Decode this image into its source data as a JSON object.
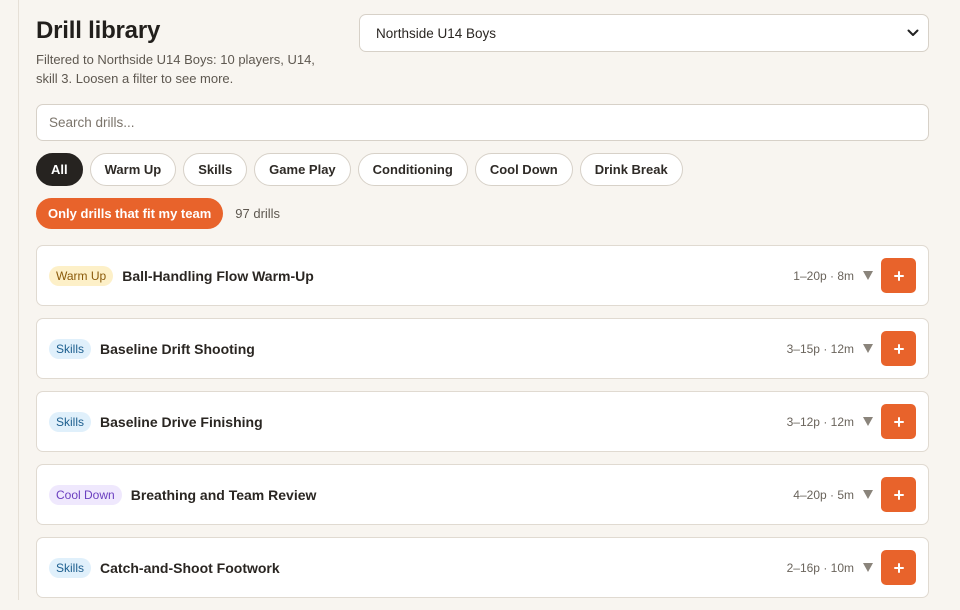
{
  "header": {
    "title": "Drill library",
    "subtitle": "Filtered to Northside U14 Boys: 10 players, U14, skill 3. Loosen a filter to see more."
  },
  "team_select": {
    "value": "Northside U14 Boys",
    "icon": "chevron-down-icon"
  },
  "search": {
    "placeholder": "Search drills...",
    "value": ""
  },
  "filters": {
    "chips": [
      {
        "label": "All",
        "active": true
      },
      {
        "label": "Warm Up",
        "active": false
      },
      {
        "label": "Skills",
        "active": false
      },
      {
        "label": "Game Play",
        "active": false
      },
      {
        "label": "Conditioning",
        "active": false
      },
      {
        "label": "Cool Down",
        "active": false
      },
      {
        "label": "Drink Break",
        "active": false
      }
    ],
    "fit_toggle_label": "Only drills that fit my team",
    "count_text": "97 drills"
  },
  "colors": {
    "accent": "#e8632b",
    "chip_active": "#262320",
    "warm_up_bg": "#fdf0c8",
    "warm_up_fg": "#8a5a0a",
    "skills_bg": "#e0f0fb",
    "skills_fg": "#1d5f8f",
    "cool_down_bg": "#efe8fd",
    "cool_down_fg": "#6b3fc0"
  },
  "drills": [
    {
      "category": "Warm Up",
      "category_key": "warm_up",
      "name": "Ball-Handling Flow Warm-Up",
      "meta": "1–20p · 8m"
    },
    {
      "category": "Skills",
      "category_key": "skills",
      "name": "Baseline Drift Shooting",
      "meta": "3–15p · 12m"
    },
    {
      "category": "Skills",
      "category_key": "skills",
      "name": "Baseline Drive Finishing",
      "meta": "3–12p · 12m"
    },
    {
      "category": "Cool Down",
      "category_key": "cool_down",
      "name": "Breathing and Team Review",
      "meta": "4–20p · 5m"
    },
    {
      "category": "Skills",
      "category_key": "skills",
      "name": "Catch-and-Shoot Footwork",
      "meta": "2–16p · 10m"
    }
  ],
  "icons": {
    "expand": "caret-down-icon",
    "add": "plus-icon"
  }
}
